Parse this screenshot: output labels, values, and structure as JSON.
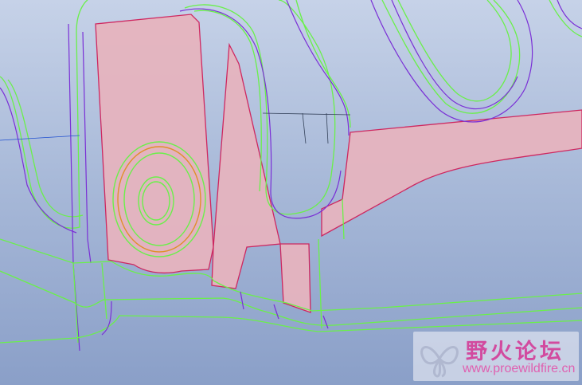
{
  "viewport": {
    "background_top": "#c6d2e8",
    "background_bottom": "#8a9fc8",
    "edge_color_green": "#6af04a",
    "edge_color_purple": "#7a2fd6",
    "highlight_fill": "#e8b8c0",
    "highlight_edge": "#d0205a"
  },
  "watermark": {
    "title": "野火论坛",
    "url": "www.proewildfire.cn",
    "color": "#d24a9f",
    "logo_icon": "butterfly-logo-icon"
  }
}
